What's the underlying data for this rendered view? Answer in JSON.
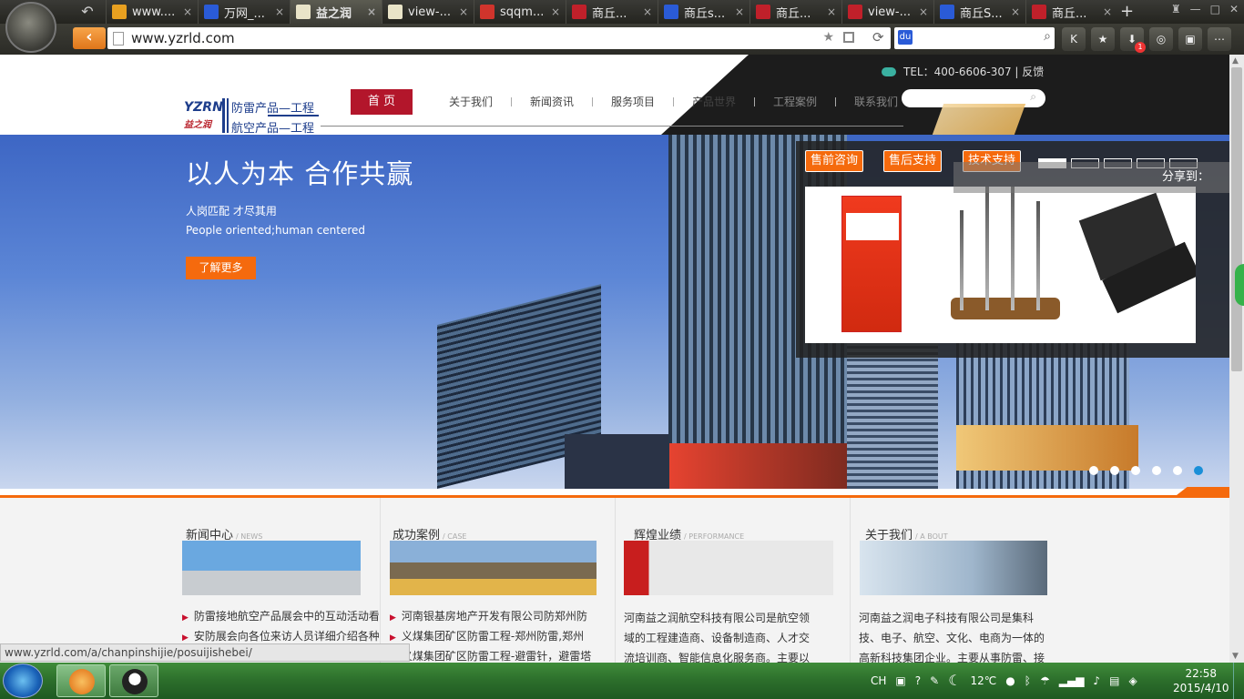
{
  "browser": {
    "tabs": [
      {
        "label": "www....",
        "fav_color": "#e8a020",
        "active": false
      },
      {
        "label": "万网_...",
        "fav_color": "#2a5bd7",
        "active": false
      },
      {
        "label": "益之润",
        "fav_color": "#e9e4c8",
        "active": true
      },
      {
        "label": "view-...",
        "fav_color": "#e9e4c8",
        "active": false
      },
      {
        "label": "sqqm...",
        "fav_color": "#d0342c",
        "active": false
      },
      {
        "label": "商丘...",
        "fav_color": "#c0202a",
        "active": false
      },
      {
        "label": "商丘s...",
        "fav_color": "#2a5bd7",
        "active": false
      },
      {
        "label": "商丘...",
        "fav_color": "#c0202a",
        "active": false
      },
      {
        "label": "view-...",
        "fav_color": "#c0202a",
        "active": false
      },
      {
        "label": "商丘S...",
        "fav_color": "#2a5bd7",
        "active": false
      },
      {
        "label": "商丘...",
        "fav_color": "#c0202a",
        "active": false
      }
    ],
    "tab_close_glyph": "×",
    "new_tab_glyph": "+",
    "back_glyph": "‹",
    "address": "www.yzrld.com",
    "download_badge": "1"
  },
  "site": {
    "tel": "TEL：400-6606-307 | 反馈",
    "logo": {
      "mark": "YZRN",
      "script": "益之润",
      "line1": "防雷产品—工程",
      "line2": "航空产品—工程"
    },
    "nav": [
      {
        "label": "首 页",
        "state": "active"
      },
      {
        "label": "关于我们",
        "state": "normal"
      },
      {
        "label": "新闻资讯",
        "state": "normal"
      },
      {
        "label": "服务项目",
        "state": "normal"
      },
      {
        "label": "产品世界",
        "state": "normal"
      },
      {
        "label": "工程案例",
        "state": "dim"
      },
      {
        "label": "联系我们",
        "state": "dim"
      }
    ],
    "banner": {
      "title": "以人为本 合作共赢",
      "sub1": "人岗匹配 才尽其用",
      "sub2": "People oriented;human centered",
      "button": "了解更多",
      "dots": 6,
      "active_dot": 5
    },
    "support": {
      "btn_presale": "售前咨询",
      "btn_aftersale": "售后支持",
      "btn_tech": "技术支持",
      "slides": 5,
      "active_slide": 0
    },
    "share_label": "分享到：",
    "sections": {
      "news": {
        "title": "新闻中心",
        "en": "/ NEWS",
        "items": [
          "防雷接地航空产品展会中的互动活动看",
          "安防展会向各位来访人员详细介绍各种"
        ]
      },
      "cases": {
        "title": "成功案例",
        "en": "/ CASE",
        "items": [
          "河南银基房地产开发有限公司防郑州防",
          "义煤集团矿区防雷工程-郑州防雷,郑州",
          "义煤集团矿区防雷工程-避雷针，避雷塔"
        ]
      },
      "performance": {
        "title": "辉煌业绩",
        "en": "/ PERFORMANCE",
        "text": "河南益之润航空科技有限公司是航空领域的工程建造商、设备制造商、人才交流培训商、智能信息化服务商。主要以"
      },
      "about": {
        "title": "关于我们",
        "en": "/ A BOUT",
        "text": "河南益之润电子科技有限公司是集科技、电子、航空、文化、电商为一体的高新科技集团企业。主要从事防雷、接"
      }
    },
    "status_url": "www.yzrld.com/a/chanpinshijie/posuijishebei/"
  },
  "taskbar": {
    "lang": "CH",
    "temp": "12℃",
    "time": "22:58",
    "date": "2015/4/10"
  },
  "colors": {
    "accent_orange": "#f56a0d",
    "nav_red": "#b3162b",
    "logo_blue": "#1e3e8c"
  }
}
